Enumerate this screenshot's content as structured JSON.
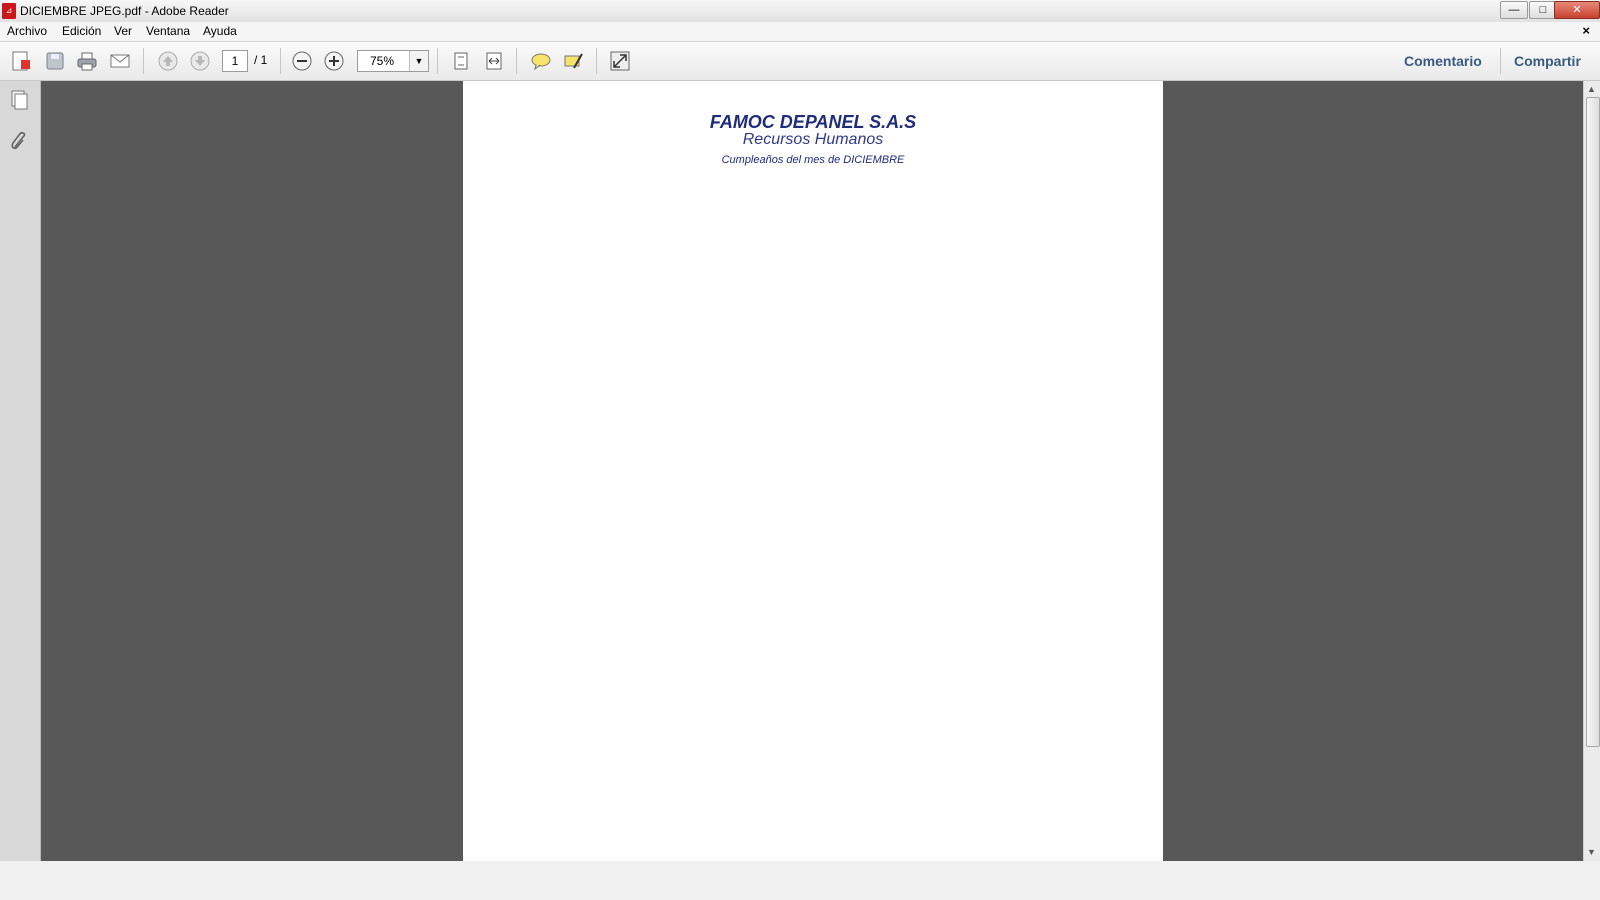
{
  "window": {
    "title": "DICIEMBRE JPEG.pdf - Adobe Reader",
    "minimize": "—",
    "maximize": "□",
    "close": "✕"
  },
  "menu": {
    "items": [
      "Archivo",
      "Edición",
      "Ver",
      "Ventana",
      "Ayuda"
    ],
    "doc_close": "×"
  },
  "toolbar": {
    "page_current": "1",
    "page_total": "/ 1",
    "zoom": "75%",
    "comment_label": "Comentario",
    "share_label": "Compartir"
  },
  "document": {
    "company": "FAMOC DEPANEL S.A.S",
    "department": "Recursos Humanos",
    "subtitle": "Cumpleaños del mes de DICIEMBRE"
  }
}
